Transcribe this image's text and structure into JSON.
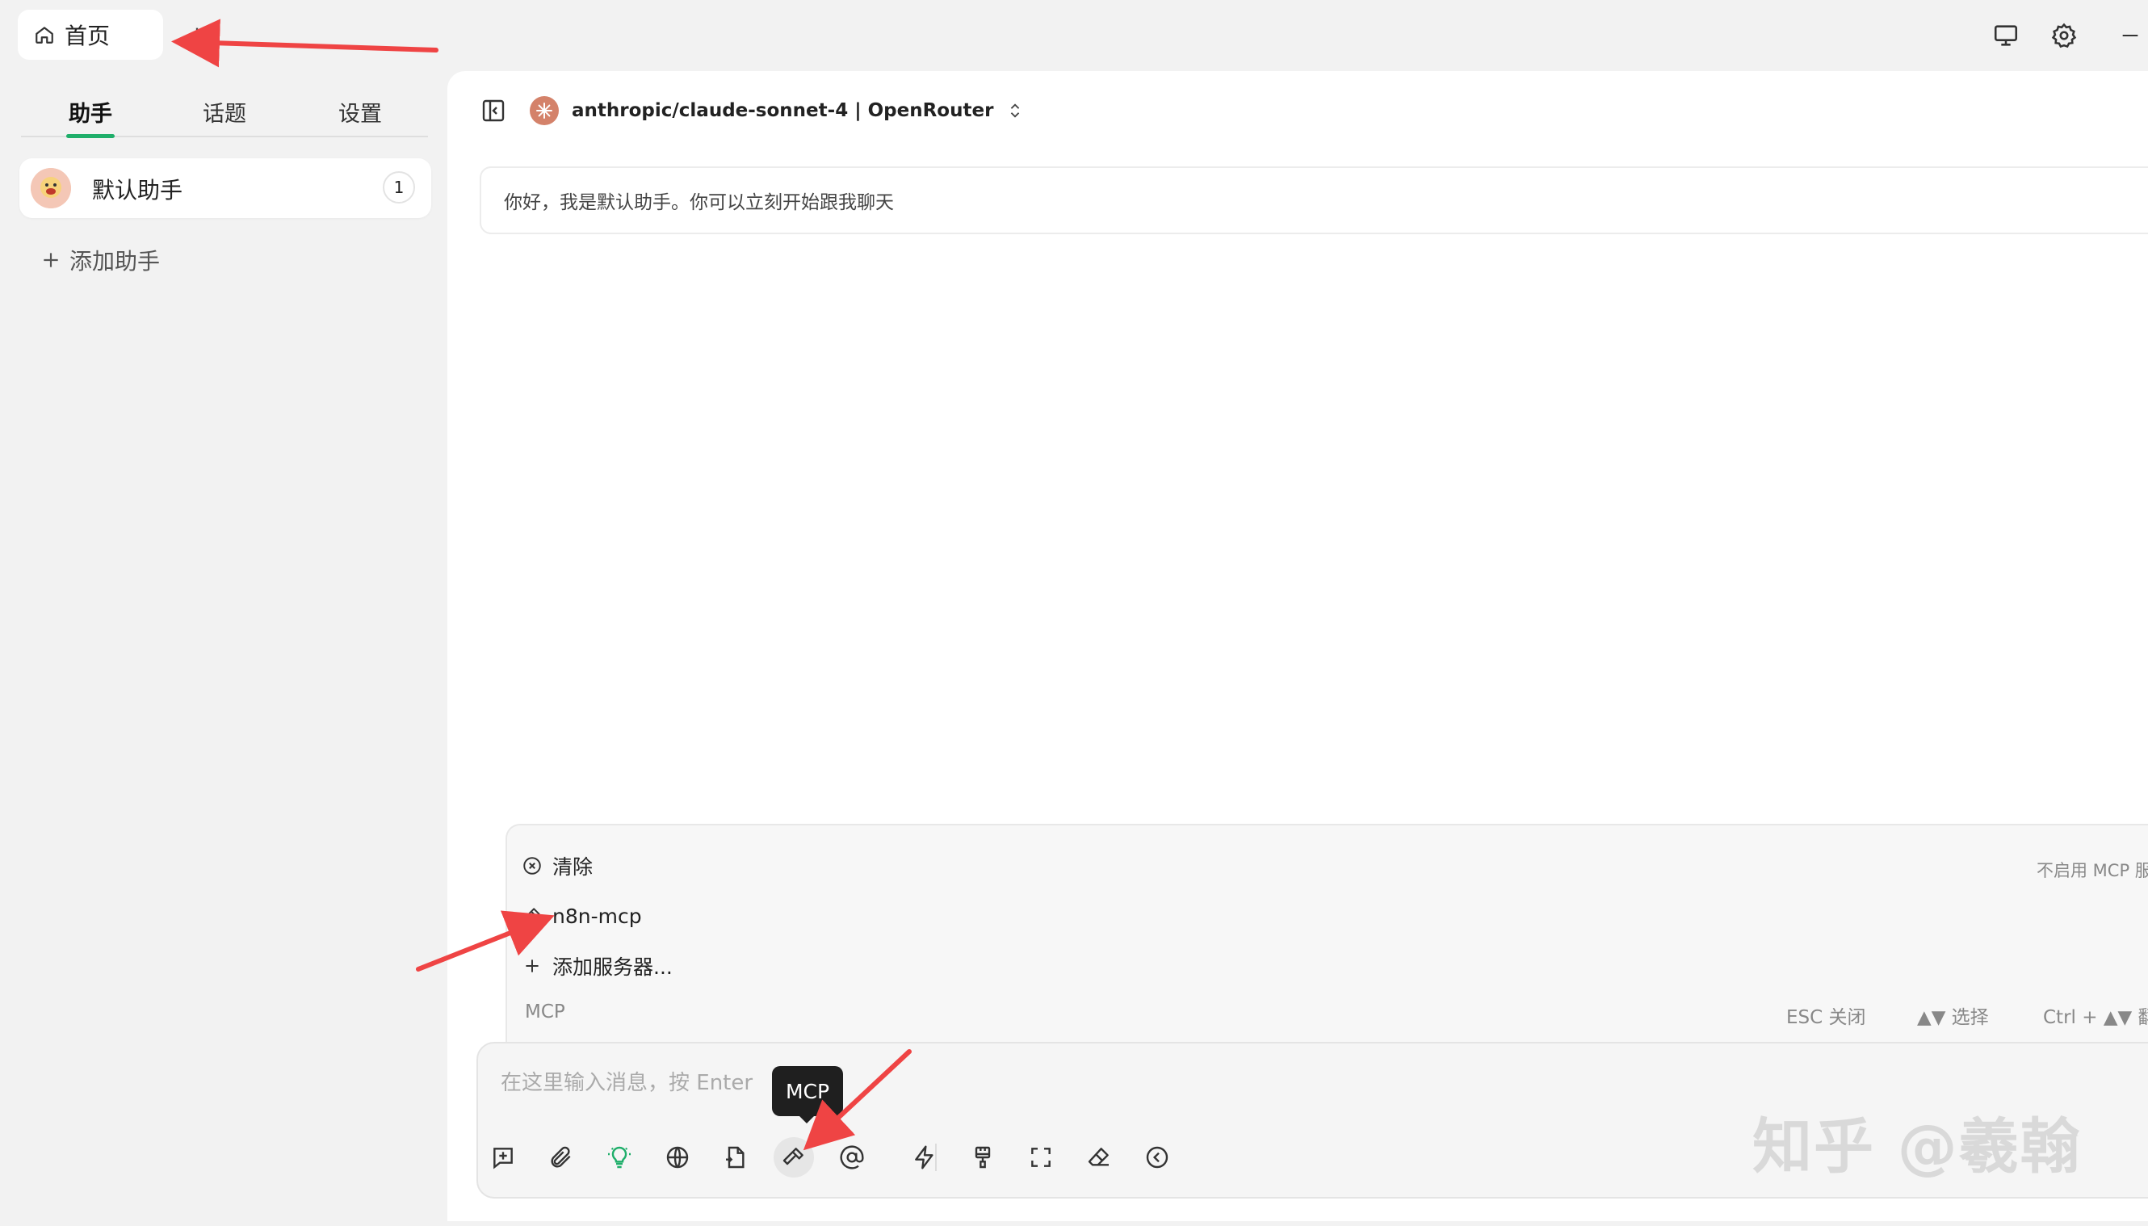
{
  "tabs": {
    "home_label": "首页"
  },
  "sidebar": {
    "nav": [
      {
        "label": "助手"
      },
      {
        "label": "话题"
      },
      {
        "label": "设置"
      }
    ],
    "assistant": {
      "name": "默认助手",
      "count": "1"
    },
    "add_assistant_label": "添加助手"
  },
  "header": {
    "model_label": "anthropic/claude-sonnet-4 | OpenRouter"
  },
  "chat": {
    "greeting": "你好，我是默认助手。你可以立刻开始跟我聊天"
  },
  "mcp_menu": {
    "items": [
      {
        "label": "清除"
      },
      {
        "label": "n8n-mcp"
      },
      {
        "label": "添加服务器..."
      }
    ],
    "hint": "不启用 MCP 服",
    "footer_title": "MCP",
    "shortcuts": [
      {
        "label": "ESC 关闭"
      },
      {
        "label": "▲▼ 选择"
      },
      {
        "label": "Ctrl + ▲▼ 翻页"
      }
    ]
  },
  "input": {
    "placeholder": "在这里输入消息，按 Enter",
    "tooltip": "MCP"
  },
  "watermark": "知乎 @羲翰",
  "colors": {
    "accent": "#1fae6a",
    "arrow": "#ef4444",
    "tooltip_bg": "#1f1f1f"
  },
  "icons": [
    "home-icon",
    "plus-icon",
    "monitor-icon",
    "gear-icon",
    "minimize-icon",
    "sidebar-toggle-icon",
    "claude-logo-icon",
    "chevron-updown-icon",
    "clear-circle-icon",
    "hammer-icon",
    "new-topic-icon",
    "paperclip-icon",
    "lightbulb-icon",
    "globe-icon",
    "file-icon",
    "at-icon",
    "lightning-icon",
    "brush-icon",
    "fullscreen-icon",
    "eraser-icon",
    "collapse-left-icon"
  ]
}
